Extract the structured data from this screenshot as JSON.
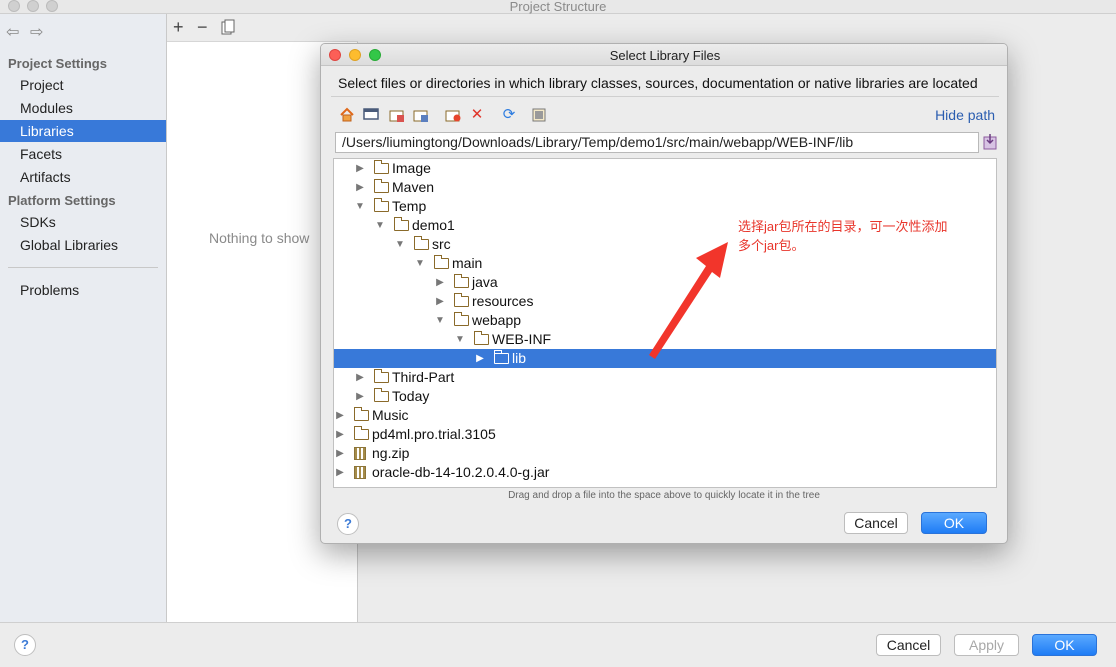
{
  "window": {
    "title": "Project Structure"
  },
  "sidebar": {
    "project_settings_header": "Project Settings",
    "project_items": [
      "Project",
      "Modules",
      "Libraries",
      "Facets",
      "Artifacts"
    ],
    "platform_settings_header": "Platform Settings",
    "platform_items": [
      "SDKs",
      "Global Libraries"
    ],
    "problems": "Problems",
    "selected": "Libraries"
  },
  "middle": {
    "add_icon": "+",
    "remove_icon": "−",
    "copy_icon": "copy-icon",
    "empty_text": "Nothing to show"
  },
  "bottom": {
    "help": "?",
    "cancel": "Cancel",
    "apply": "Apply",
    "ok": "OK"
  },
  "dialog": {
    "title": "Select Library Files",
    "description": "Select files or directories in which library classes, sources, documentation or native libraries are located",
    "hide_path": "Hide path",
    "path": "/Users/liumingtong/Downloads/Library/Temp/demo1/src/main/webapp/WEB-INF/lib",
    "drag_hint": "Drag and drop a file into the space above to quickly locate it in the tree",
    "help": "?",
    "cancel": "Cancel",
    "ok": "OK",
    "toolbar_icons": [
      "home-icon",
      "desktop-icon",
      "project-folder-icon",
      "module-folder-icon",
      "new-folder-icon",
      "delete-icon",
      "refresh-icon",
      "show-hidden-icon"
    ],
    "tree": [
      {
        "label": "Image",
        "kind": "folder",
        "state": "collapsed",
        "level": 5
      },
      {
        "label": "Maven",
        "kind": "folder",
        "state": "collapsed",
        "level": 5
      },
      {
        "label": "Temp",
        "kind": "folder",
        "state": "expanded",
        "level": 5
      },
      {
        "label": "demo1",
        "kind": "folder",
        "state": "expanded",
        "level": 6
      },
      {
        "label": "src",
        "kind": "folder",
        "state": "expanded",
        "level": 7
      },
      {
        "label": "main",
        "kind": "folder",
        "state": "expanded",
        "level": 8
      },
      {
        "label": "java",
        "kind": "folder",
        "state": "collapsed",
        "level": 9
      },
      {
        "label": "resources",
        "kind": "folder",
        "state": "collapsed",
        "level": 9
      },
      {
        "label": "webapp",
        "kind": "folder",
        "state": "expanded",
        "level": 9
      },
      {
        "label": "WEB-INF",
        "kind": "folder",
        "state": "expanded",
        "level": 10
      },
      {
        "label": "lib",
        "kind": "folder",
        "state": "collapsed",
        "level": 11,
        "selected": true
      },
      {
        "label": "Third-Part",
        "kind": "folder",
        "state": "collapsed",
        "level": 5
      },
      {
        "label": "Today",
        "kind": "folder",
        "state": "collapsed",
        "level": 5
      },
      {
        "label": "Music",
        "kind": "folder",
        "state": "collapsed",
        "level": 4
      },
      {
        "label": "pd4ml.pro.trial.3105",
        "kind": "folder",
        "state": "collapsed",
        "level": 4
      },
      {
        "label": "ng.zip",
        "kind": "archive",
        "state": "collapsed",
        "level": 4
      },
      {
        "label": "oracle-db-14-10.2.0.4.0-g.jar",
        "kind": "archive",
        "state": "collapsed",
        "level": 4
      }
    ]
  },
  "annotation": {
    "line1": "选择jar包所在的目录，可一次性添加",
    "line2": "多个jar包。",
    "color": "#e8352b"
  },
  "colors": {
    "selection": "#3879d9",
    "primary_button": "#1e7cf5"
  }
}
